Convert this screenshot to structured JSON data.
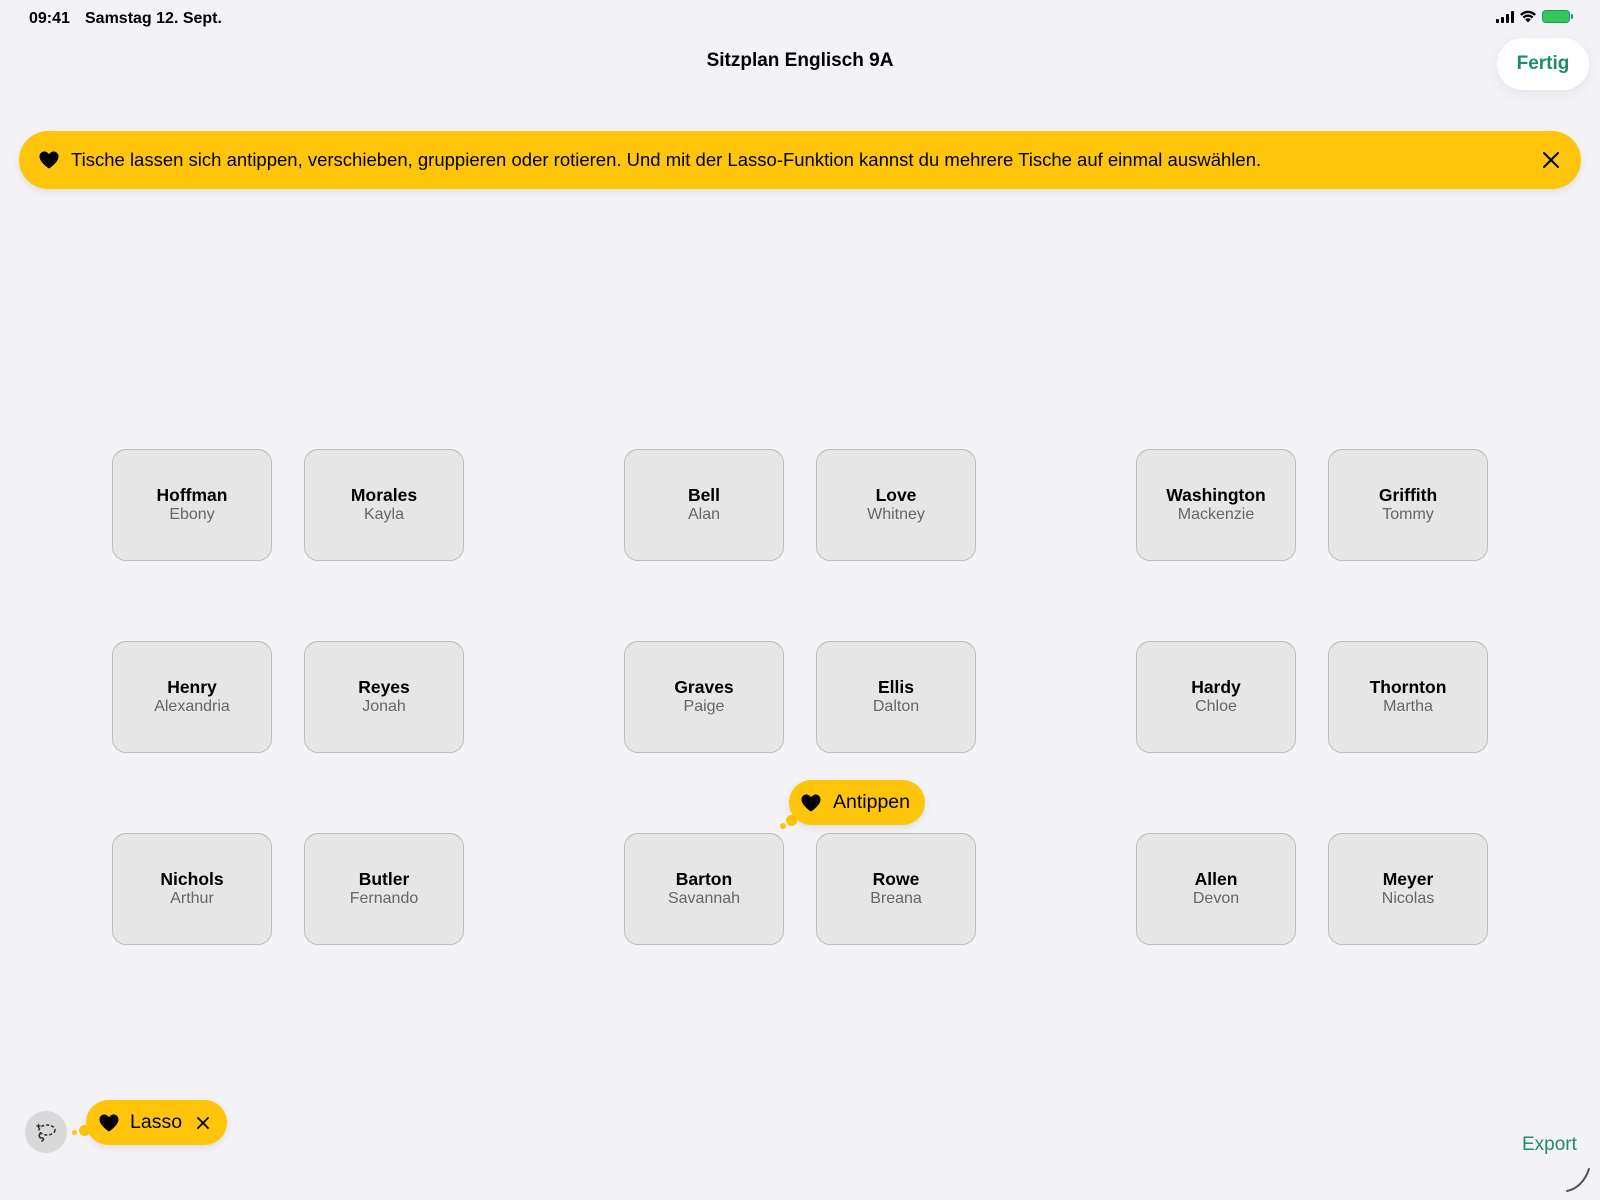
{
  "status_bar": {
    "time": "09:41",
    "date": "Samstag 12. Sept."
  },
  "nav": {
    "title": "Sitzplan Englisch 9A",
    "done_label": "Fertig"
  },
  "banner": {
    "text": "Tische lassen sich antippen, verschieben, gruppieren oder rotieren. Und mit der Lasso-Funktion kannst du mehrere Tische auf einmal auswählen.",
    "icon": "heart-icon",
    "close_icon": "close-icon"
  },
  "desks": [
    {
      "last": "Hoffman",
      "first": "Ebony"
    },
    {
      "last": "Morales",
      "first": "Kayla"
    },
    {
      "last": "Bell",
      "first": "Alan"
    },
    {
      "last": "Love",
      "first": "Whitney"
    },
    {
      "last": "Washington",
      "first": "Mackenzie"
    },
    {
      "last": "Griffith",
      "first": "Tommy"
    },
    {
      "last": "Henry",
      "first": "Alexandria"
    },
    {
      "last": "Reyes",
      "first": "Jonah"
    },
    {
      "last": "Graves",
      "first": "Paige"
    },
    {
      "last": "Ellis",
      "first": "Dalton"
    },
    {
      "last": "Hardy",
      "first": "Chloe"
    },
    {
      "last": "Thornton",
      "first": "Martha"
    },
    {
      "last": "Nichols",
      "first": "Arthur"
    },
    {
      "last": "Butler",
      "first": "Fernando"
    },
    {
      "last": "Barton",
      "first": "Savannah"
    },
    {
      "last": "Rowe",
      "first": "Breana"
    },
    {
      "last": "Allen",
      "first": "Devon"
    },
    {
      "last": "Meyer",
      "first": "Nicolas"
    }
  ],
  "tips": {
    "tap_label": "Antippen",
    "lasso_label": "Lasso"
  },
  "footer": {
    "export_label": "Export"
  },
  "colors": {
    "accent": "#1e8c66",
    "tip_yellow": "#ffc50a",
    "desk_fill": "#e6e6e6",
    "background": "#f2f2f7"
  }
}
